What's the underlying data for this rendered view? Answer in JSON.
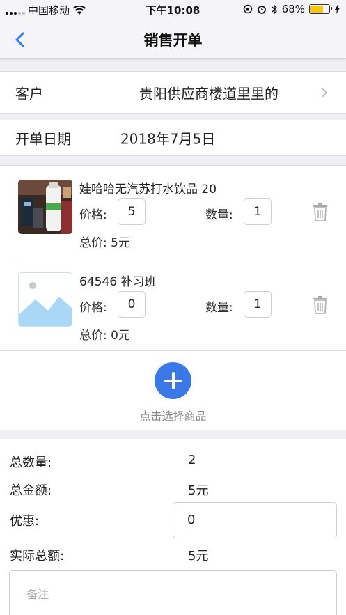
{
  "status_bar": {
    "carrier": "中国移动",
    "time": "下午10:08",
    "battery_percent": "68%",
    "battery_level": 0.68,
    "icons": [
      "wifi-icon",
      "lock-rotation-icon",
      "alarm-icon",
      "bluetooth-icon",
      "battery-icon",
      "charging-icon"
    ]
  },
  "header": {
    "title": "销售开单",
    "back_icon": "chevron-left-icon",
    "accent": "#2f7cf6"
  },
  "customer": {
    "label": "客户",
    "value": "贵阳供应商楼道里里的"
  },
  "order_date": {
    "label": "开单日期",
    "value": "2018年7月5日"
  },
  "items": [
    {
      "name": "娃哈哈无汽苏打水饮品 20",
      "price_label": "价格:",
      "price": "5",
      "qty_label": "数量:",
      "qty": "1",
      "total": "总价: 5元",
      "image": "product-photo"
    },
    {
      "name": "64546 补习班",
      "price_label": "价格:",
      "price": "0",
      "qty_label": "数量:",
      "qty": "1",
      "total": "总价: 0元",
      "image": "image-placeholder-icon"
    }
  ],
  "add_product": {
    "label": "点击选择商品",
    "color": "#3b78e7"
  },
  "summary": {
    "total_qty_label": "总数量:",
    "total_qty": "2",
    "total_amount_label": "总金额:",
    "total_amount": "5元",
    "discount_label": "优惠:",
    "discount": "0",
    "actual_total_label": "实际总额:",
    "actual_total": "5元"
  },
  "remark": {
    "placeholder": "备注"
  }
}
